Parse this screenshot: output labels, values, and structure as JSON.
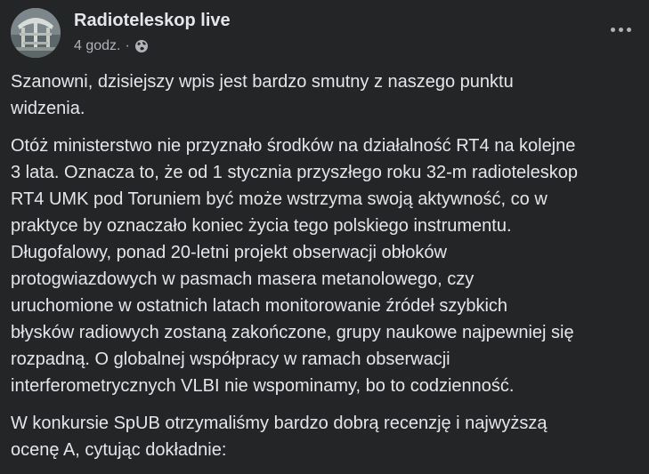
{
  "post": {
    "author": "Radioteleskop live",
    "timestamp": "4 godz.",
    "separator": "·",
    "audience_icon": "globe-icon",
    "more_icon": "more-horizontal-icon",
    "avatar_icon": "radio-telescope-avatar",
    "paragraphs": [
      [
        "Szanowni, dzisiejszy wpis jest bardzo smutny z naszego punktu",
        "widzenia."
      ],
      [
        "Otóż ministerstwo nie przyznało środków na działalność RT4 na kolejne",
        "3 lata. Oznacza to, że od 1 stycznia przyszłego roku 32-m radioteleskop",
        "RT4 UMK pod Toruniem być może wstrzyma swoją aktywność, co w",
        "praktyce by oznaczało koniec życia tego polskiego instrumentu.",
        "Długofalowy, ponad 20-letni projekt obserwacji obłoków",
        "protogwiazdowych w pasmach masera metanolowego, czy",
        "uruchomione w ostatnich latach monitorowanie źródeł szybkich",
        "błysków radiowych zostaną zakończone, grupy naukowe najpewniej się",
        "rozpadną. O globalnej współpracy w ramach obserwacji",
        "interferometrycznych VLBI nie wspominamy, bo to codzienność."
      ],
      [
        "W konkursie SpUB otrzymaliśmy bardzo dobrą recenzję i najwyższą",
        "ocenę A, cytując dokładnie:"
      ]
    ]
  },
  "colors": {
    "background": "#242526",
    "text_primary": "#e4e6eb",
    "text_secondary": "#b0b3b8"
  }
}
